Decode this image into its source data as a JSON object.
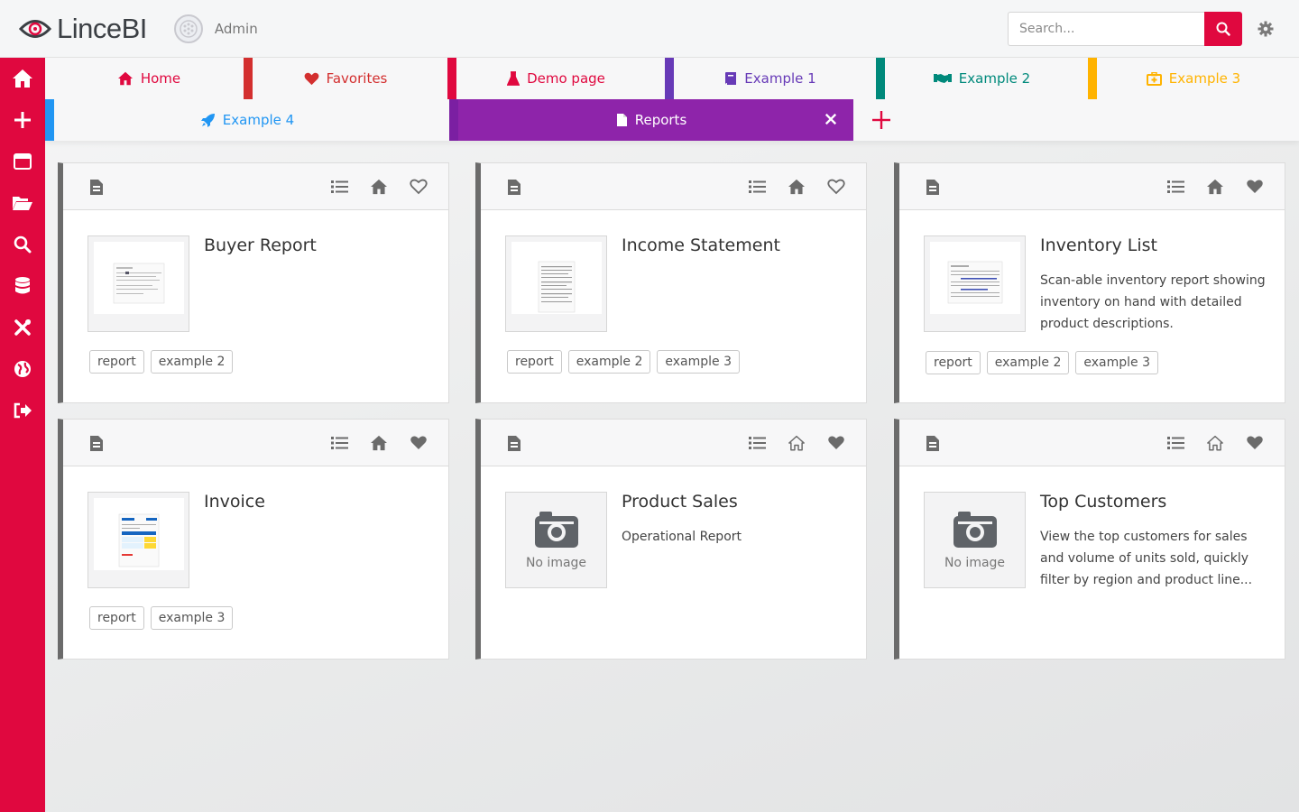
{
  "brand": {
    "name": "LinceBI",
    "logo_icon": "eye-logo-icon"
  },
  "user": {
    "name": "Admin"
  },
  "search": {
    "placeholder": "Search..."
  },
  "colors": {
    "primary": "#e0083f",
    "reports_tab": "#8e24aa"
  },
  "sidebar": {
    "items": [
      {
        "icon": "home-icon"
      },
      {
        "icon": "plus-icon"
      },
      {
        "icon": "window-icon"
      },
      {
        "icon": "folder-open-icon"
      },
      {
        "icon": "search-icon"
      },
      {
        "icon": "database-icon"
      },
      {
        "icon": "tools-icon"
      },
      {
        "icon": "globe-icon"
      },
      {
        "icon": "sign-out-icon"
      }
    ]
  },
  "tabs": [
    {
      "label": "Home",
      "icon": "home-icon",
      "color": "#e0083f"
    },
    {
      "label": "Favorites",
      "icon": "heart-icon",
      "color": "#d32f2f"
    },
    {
      "label": "Demo page",
      "icon": "flask-icon",
      "color": "#e0083f"
    },
    {
      "label": "Example 1",
      "icon": "book-icon",
      "color": "#673ab7"
    },
    {
      "label": "Example 2",
      "icon": "handshake-icon",
      "color": "#00897b"
    },
    {
      "label": "Example 3",
      "icon": "first-aid-icon",
      "color": "#ffb300"
    },
    {
      "label": "Example 4",
      "icon": "rocket-icon",
      "color": "#2196f3"
    },
    {
      "label": "Reports",
      "icon": "file-icon",
      "color": "#ffffff",
      "active": true
    }
  ],
  "cards": [
    {
      "title": "Buyer Report",
      "description": "",
      "tags": [
        "report",
        "example 2"
      ],
      "image": true,
      "home": "filled",
      "favorite": "outline"
    },
    {
      "title": "Income Statement",
      "description": "",
      "tags": [
        "report",
        "example 2",
        "example 3"
      ],
      "image": true,
      "home": "filled",
      "favorite": "outline"
    },
    {
      "title": "Inventory List",
      "description": "Scan-able inventory report showing inventory on hand with detailed product descriptions.",
      "tags": [
        "report",
        "example 2",
        "example 3"
      ],
      "image": true,
      "home": "filled",
      "favorite": "filled"
    },
    {
      "title": "Invoice",
      "description": "",
      "tags": [
        "report",
        "example 3"
      ],
      "image": true,
      "home": "filled",
      "favorite": "filled"
    },
    {
      "title": "Product Sales",
      "description": "Operational Report",
      "tags": [],
      "image": false,
      "no_image_text": "No image",
      "home": "outline",
      "favorite": "filled"
    },
    {
      "title": "Top Customers",
      "description": "View the top customers for sales and volume of units sold, quickly filter by region and product line...",
      "tags": [],
      "image": false,
      "no_image_text": "No image",
      "home": "outline",
      "favorite": "filled"
    }
  ]
}
